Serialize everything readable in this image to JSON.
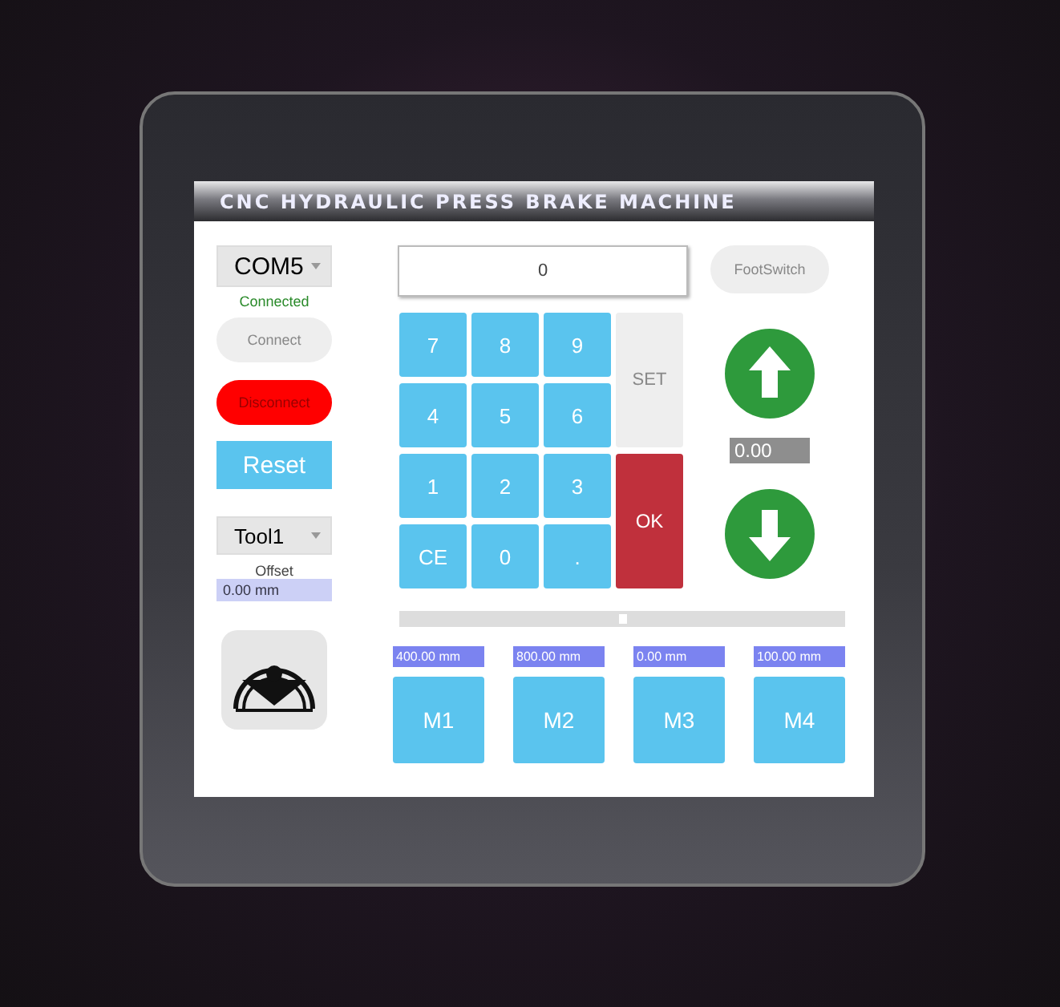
{
  "title": "CNC HYDRAULIC PRESS BRAKE MACHINE",
  "port_select": {
    "value": "COM5"
  },
  "status": "Connected",
  "connect_button": "Connect",
  "disconnect_button": "Disconnect",
  "reset_button": "Reset",
  "tool_select": {
    "value": "Tool1"
  },
  "offset": {
    "label": "Offset",
    "value": "0.00 mm"
  },
  "display": {
    "value": "0"
  },
  "footswitch_button": "FootSwitch",
  "keypad": [
    {
      "label": "7",
      "kind": "digit"
    },
    {
      "label": "8",
      "kind": "digit"
    },
    {
      "label": "9",
      "kind": "digit"
    },
    {
      "label": "SET",
      "kind": "set"
    },
    {
      "label": "4",
      "kind": "digit"
    },
    {
      "label": "5",
      "kind": "digit"
    },
    {
      "label": "6",
      "kind": "digit"
    },
    {
      "label": "1",
      "kind": "digit"
    },
    {
      "label": "2",
      "kind": "digit"
    },
    {
      "label": "3",
      "kind": "digit"
    },
    {
      "label": "OK",
      "kind": "ok"
    },
    {
      "label": "CE",
      "kind": "digit"
    },
    {
      "label": "0",
      "kind": "digit"
    },
    {
      "label": ".",
      "kind": "digit"
    }
  ],
  "position_reading": "0.00",
  "slider": {
    "level": 0.5
  },
  "memories": [
    {
      "value": "400.00 mm",
      "label": "M1"
    },
    {
      "value": "800.00 mm",
      "label": "M2"
    },
    {
      "value": "0.00 mm",
      "label": "M3"
    },
    {
      "value": "100.00 mm",
      "label": "M4"
    }
  ]
}
